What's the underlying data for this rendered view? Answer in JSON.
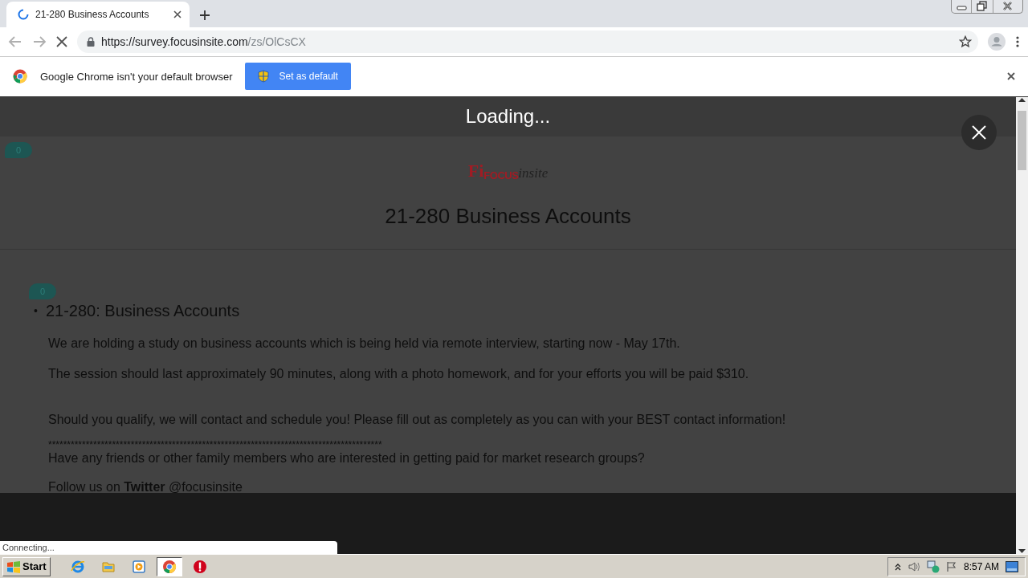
{
  "browser": {
    "tabs": [
      {
        "title": "21-280 Business Accounts",
        "loading": true,
        "selected": true
      }
    ],
    "url": {
      "host": "https://survey.focusinsite.com",
      "path": "/zs/OlCsCX"
    }
  },
  "infobar": {
    "message": "Google Chrome isn't your default browser",
    "button": "Set as default"
  },
  "overlay": {
    "title": "Loading..."
  },
  "page": {
    "badges": [
      "0",
      "0"
    ],
    "logo": {
      "mark": "Fi",
      "name": "FOCUS",
      "suffix": "insite"
    },
    "title": "21-280 Business Accounts",
    "bullet": "•",
    "heading": "21-280: Business Accounts",
    "paragraphs": [
      "We are holding a study on business accounts which is being held via remote interview, starting now - May 17th.",
      "The session should last approximately 90 minutes, along with a photo homework, and for your efforts you will be paid $310.",
      "Should you qualify, we will contact and schedule you! Please fill out as completely as you can with your BEST contact information!"
    ],
    "divider": "*****************************************************************************************",
    "question": "Have any friends or other family members who are interested in getting paid for market research groups?",
    "follow": "Follow us on **Twitter** @focusinsite"
  },
  "status": "Connecting...",
  "taskbar": {
    "start": "Start",
    "apps": [
      {
        "kind": "ie",
        "selected": false
      },
      {
        "kind": "folder",
        "selected": false
      },
      {
        "kind": "media",
        "selected": false
      },
      {
        "kind": "chrome",
        "selected": true
      },
      {
        "kind": "stop",
        "selected": false
      }
    ],
    "clock": "8:57 AM"
  }
}
